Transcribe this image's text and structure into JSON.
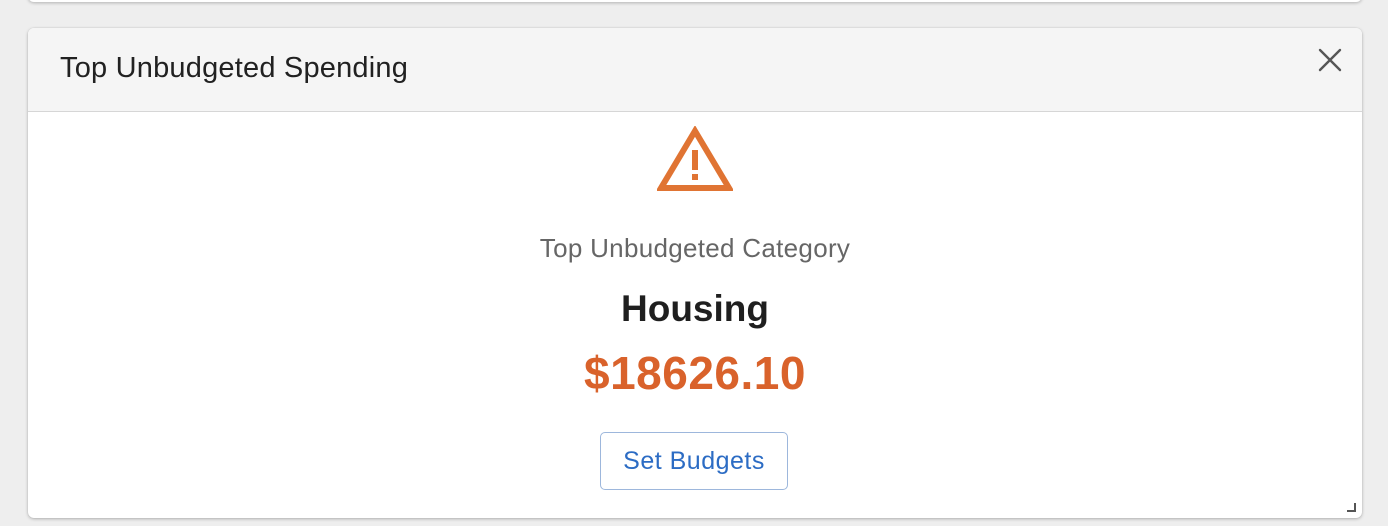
{
  "widget": {
    "title": "Top Unbudgeted Spending",
    "close_icon": "close-icon",
    "warning_icon": "warning-triangle-icon",
    "subtitle": "Top Unbudgeted Category",
    "category": "Housing",
    "amount": "$18626.10",
    "button_label": "Set Budgets"
  },
  "colors": {
    "accent_warning": "#E07433",
    "amount": "#D9622B",
    "button_text": "#2C6CC4",
    "header_bg": "#F5F5F5"
  }
}
